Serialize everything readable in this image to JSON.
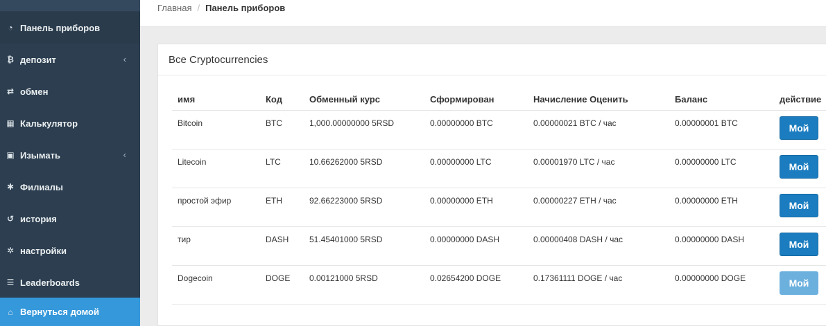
{
  "sidebar": {
    "items": [
      {
        "label": "Панель приборов",
        "icon": "dashboard-icon",
        "glyph": "◔"
      },
      {
        "label": "депозит",
        "icon": "bitcoin-icon",
        "glyph": "₿",
        "chevron": "‹"
      },
      {
        "label": "обмен",
        "icon": "exchange-icon",
        "glyph": "⇄"
      },
      {
        "label": "Калькулятор",
        "icon": "calculator-icon",
        "glyph": "▦"
      },
      {
        "label": "Изымать",
        "icon": "money-icon",
        "glyph": "▣",
        "chevron": "‹"
      },
      {
        "label": "Филиалы",
        "icon": "users-icon",
        "glyph": "✱"
      },
      {
        "label": "история",
        "icon": "history-icon",
        "glyph": "↺"
      },
      {
        "label": "настройки",
        "icon": "gear-icon",
        "glyph": "✲"
      },
      {
        "label": "Leaderboards",
        "icon": "list-icon",
        "glyph": "☰"
      },
      {
        "label": "Вернуться домой",
        "icon": "home-icon",
        "glyph": "⌂"
      }
    ]
  },
  "breadcrumb": {
    "home": "Главная",
    "separator": "/",
    "current": "Панель приборов"
  },
  "panel": {
    "title": "Все Cryptocurrencies"
  },
  "table": {
    "headers": [
      "имя",
      "Код",
      "Обменный курс",
      "Сформирован",
      "Начисление Оценить",
      "Баланс",
      "действие"
    ],
    "rows": [
      {
        "name": "Bitcoin",
        "code": "BTC",
        "rate": "1,000.00000000 5RSD",
        "generated": "0.00000000 BTC",
        "accrual": "0.00000021 BTC / час",
        "balance": "0.00000001 BTC",
        "action": "Мой",
        "enabled": true
      },
      {
        "name": "Litecoin",
        "code": "LTC",
        "rate": "10.66262000 5RSD",
        "generated": "0.00000000 LTC",
        "accrual": "0.00001970 LTC / час",
        "balance": "0.00000000 LTC",
        "action": "Мой",
        "enabled": true
      },
      {
        "name": "простой эфир",
        "code": "ETH",
        "rate": "92.66223000 5RSD",
        "generated": "0.00000000 ETH",
        "accrual": "0.00000227 ETH / час",
        "balance": "0.00000000 ETH",
        "action": "Мой",
        "enabled": true
      },
      {
        "name": "тир",
        "code": "DASH",
        "rate": "51.45401000 5RSD",
        "generated": "0.00000000 DASH",
        "accrual": "0.00000408 DASH / час",
        "balance": "0.00000000 DASH",
        "action": "Мой",
        "enabled": true
      },
      {
        "name": "Dogecoin",
        "code": "DOGE",
        "rate": "0.00121000 5RSD",
        "generated": "0.02654200 DOGE",
        "accrual": "0.17361111 DOGE / час",
        "balance": "0.00000000 DOGE",
        "action": "Мой",
        "enabled": false
      }
    ]
  },
  "colors": {
    "sidebar_bg": "#2c3e50",
    "active_bg": "#3498db",
    "button_bg": "#1b7dc0",
    "button_disabled_bg": "#6cb0de"
  }
}
